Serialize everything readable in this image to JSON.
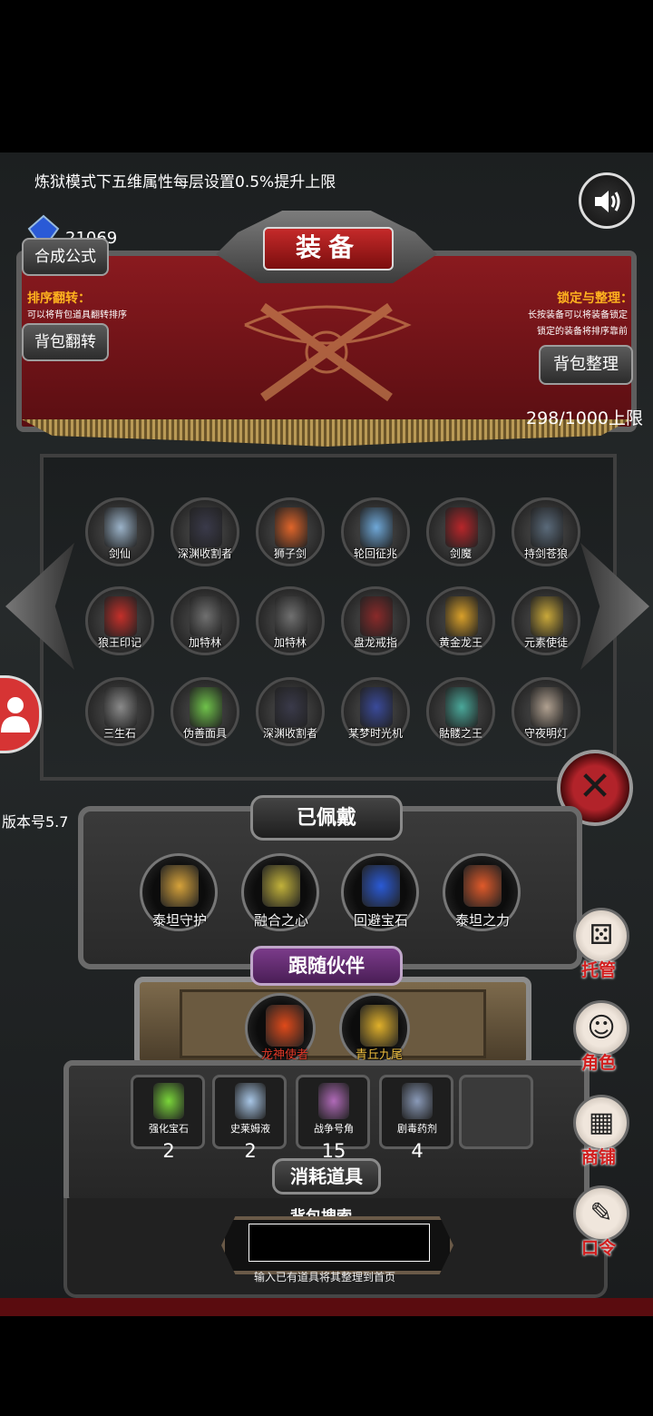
{
  "notice": "炼狱模式下五维属性每层设置0.5%提升上限",
  "gem_count": "21069",
  "title": "装备",
  "buttons": {
    "formula": "合成公式",
    "flip": "背包翻转",
    "sort": "背包整理"
  },
  "sort_info": {
    "title": "排序翻转：",
    "desc": "可以将背包道具翻转排序"
  },
  "lock_info": {
    "title": "锁定与整理：",
    "desc1": "长按装备可以将装备锁定",
    "desc2": "锁定的装备将排序靠前"
  },
  "capacity": "298/1000上限",
  "version": "版本号5.7",
  "grid_items": [
    {
      "label": "剑仙",
      "color": "#9bb3c9"
    },
    {
      "label": "深渊收割者",
      "color": "#3a3a4a"
    },
    {
      "label": "狮子剑",
      "color": "#e0652a"
    },
    {
      "label": "轮回征兆",
      "color": "#6fa8d8"
    },
    {
      "label": "剑魔",
      "color": "#b8262a"
    },
    {
      "label": "持剑苍狼",
      "color": "#5a6a7a"
    },
    {
      "label": "狼王印记",
      "color": "#c5302a"
    },
    {
      "label": "加特林",
      "color": "#707070"
    },
    {
      "label": "加特林",
      "color": "#707070"
    },
    {
      "label": "盘龙戒指",
      "color": "#8a2a2a"
    },
    {
      "label": "黄金龙王",
      "color": "#d9a02a"
    },
    {
      "label": "元素使徒",
      "color": "#c9a83a"
    },
    {
      "label": "三生石",
      "color": "#8a8a8a"
    },
    {
      "label": "伪善面具",
      "color": "#6fc24a"
    },
    {
      "label": "深渊收割者",
      "color": "#3a3a4a"
    },
    {
      "label": "某梦时光机",
      "color": "#3a4a9a"
    },
    {
      "label": "骷髅之王",
      "color": "#4aa89a"
    },
    {
      "label": "守夜明灯",
      "color": "#b0a090"
    }
  ],
  "equipped": {
    "title": "已佩戴",
    "items": [
      {
        "label": "泰坦守护",
        "color": "#d6a23a"
      },
      {
        "label": "融合之心",
        "color": "#c2b23a"
      },
      {
        "label": "回避宝石",
        "color": "#2a5ad6"
      },
      {
        "label": "泰坦之力",
        "color": "#e05a2a"
      }
    ]
  },
  "companion": {
    "title": "跟随伙伴",
    "items": [
      {
        "label": "龙神使者",
        "color": "#e04a1a"
      },
      {
        "label": "青丘九尾",
        "color": "#e0b02a"
      }
    ]
  },
  "consumables": {
    "title": "消耗道具",
    "items": [
      {
        "label": "强化宝石",
        "count": "2",
        "color": "#7ad63a"
      },
      {
        "label": "史莱姆液",
        "count": "2",
        "color": "#a8c6e6"
      },
      {
        "label": "战争号角",
        "count": "15",
        "color": "#b06ab8"
      },
      {
        "label": "剧毒药剂",
        "count": "4",
        "color": "#8a9ab8"
      }
    ]
  },
  "search": {
    "label": "背包搜索",
    "value": "",
    "hint": "输入已有道具将其整理到首页"
  },
  "side_menu": [
    {
      "label": "托管",
      "icon": "dice-icon"
    },
    {
      "label": "角色",
      "icon": "hooded-figure-icon"
    },
    {
      "label": "商铺",
      "icon": "shop-icon"
    },
    {
      "label": "口令",
      "icon": "scroll-icon"
    }
  ]
}
